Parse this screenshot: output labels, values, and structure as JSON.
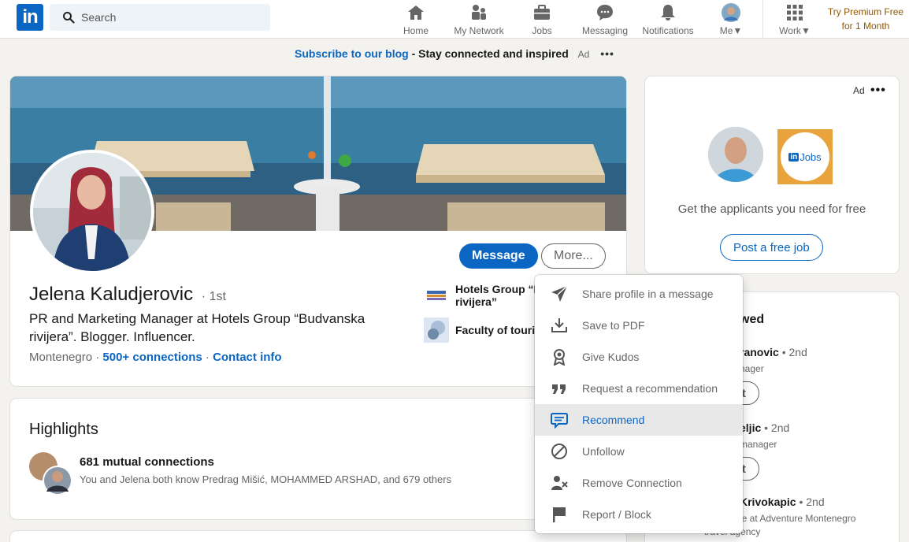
{
  "nav": {
    "logo": "in",
    "search_placeholder": "Search",
    "items": [
      {
        "label": "Home"
      },
      {
        "label": "My Network"
      },
      {
        "label": "Jobs"
      },
      {
        "label": "Messaging"
      },
      {
        "label": "Notifications"
      },
      {
        "label": "Me"
      },
      {
        "label": "Work"
      }
    ],
    "premium_line1": "Try Premium Free",
    "premium_line2": "for 1 Month"
  },
  "ad_banner": {
    "link": "Subscribe to our blog",
    "separator": " - ",
    "text": "Stay connected and inspired",
    "ad_label": "Ad",
    "more": "•••"
  },
  "profile": {
    "name": "Jelena Kaludjerovic",
    "degree": "· 1st",
    "headline": "PR and Marketing Manager at Hotels Group “Budvanska rivijera”. Blogger. Influencer.",
    "location": "Montenegro",
    "dot": " · ",
    "connections": "500+ connections",
    "contact": "Contact info",
    "message_btn": "Message",
    "more_btn": "More...",
    "experience": [
      {
        "name": "Hotels Group “B",
        "name2": "rivijera”"
      },
      {
        "name": "Faculty of touris"
      }
    ]
  },
  "highlights": {
    "title": "Highlights",
    "mutual": "681 mutual connections",
    "mutual_sub": "You and Jelena both know Predrag Mišić, MOHAMMED ARSHAD, and 679 others"
  },
  "ad_card": {
    "ad_label": "Ad",
    "more": "•••",
    "jobs_in": "in",
    "jobs_label": "Jobs",
    "text": "Get the applicants you need for free",
    "button": "Post a free job"
  },
  "people_viewed": {
    "title_fragment": "wed",
    "people": [
      {
        "name": "ranovic",
        "degree": "• 2nd",
        "sub": "nager",
        "button": "nect"
      },
      {
        "name": "eljic",
        "degree": "• 2nd",
        "sub": "manager",
        "button": "nect"
      },
      {
        "name": "Krivokapic",
        "degree": "• 2nd",
        "sub": "le at Adventure Montenegro",
        "sub2": "travel agency"
      }
    ]
  },
  "more_menu": {
    "items": [
      {
        "label": "Share profile in a message",
        "icon": "send-icon"
      },
      {
        "label": "Save to PDF",
        "icon": "download-icon"
      },
      {
        "label": "Give Kudos",
        "icon": "award-icon"
      },
      {
        "label": "Request a recommendation",
        "icon": "quote-icon"
      },
      {
        "label": "Recommend",
        "icon": "chat-bubble-icon",
        "active": true
      },
      {
        "label": "Unfollow",
        "icon": "block-icon"
      },
      {
        "label": "Remove Connection",
        "icon": "remove-person-icon"
      },
      {
        "label": "Report / Block",
        "icon": "flag-icon"
      }
    ]
  },
  "colors": {
    "brand": "#0a66c2",
    "premium": "#915907",
    "background": "#f3f2ef"
  }
}
